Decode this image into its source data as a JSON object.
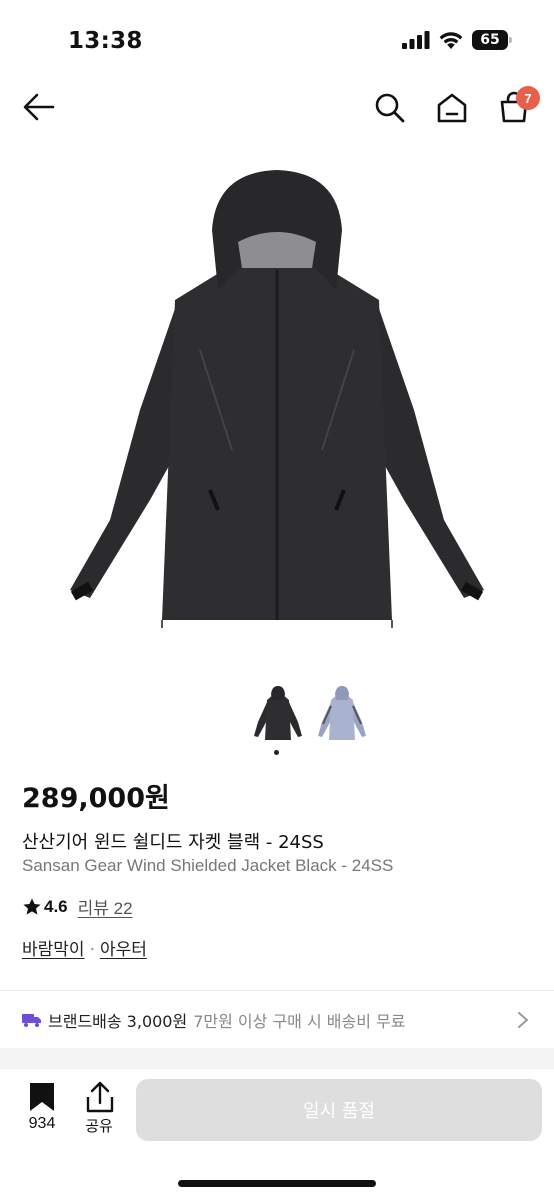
{
  "status_bar": {
    "time": "13:38",
    "battery": "65"
  },
  "nav": {
    "back_icon": "arrow-left-icon",
    "search_icon": "search-icon",
    "home_icon": "home-icon",
    "cart_icon": "shopping-bag-icon",
    "cart_badge": "7",
    "badge_color": "#e8604c"
  },
  "product": {
    "thumbnails": [
      {
        "icon": "jacket-thumbnail-black"
      },
      {
        "icon": "jacket-thumbnail-blue"
      }
    ],
    "price": "289,000원",
    "title_ko": "산산기어 윈드 쉴디드 자켓 블랙 - 24SS",
    "title_en": "Sansan Gear Wind Shielded Jacket Black - 24SS",
    "rating": "4.6",
    "review_link": "리뷰 22",
    "category_1": "바람막이",
    "category_separator": "·",
    "category_2": "아우터"
  },
  "shipping": {
    "label": "브랜드배송 3,000원",
    "note": "7만원 이상 구매 시 배송비 무료",
    "truck_color": "#6b4fd8"
  },
  "bottom_bar": {
    "bookmark_count": "934",
    "share_label": "공유",
    "cta_label": "일시 품절",
    "cta_color": "#dedede"
  }
}
